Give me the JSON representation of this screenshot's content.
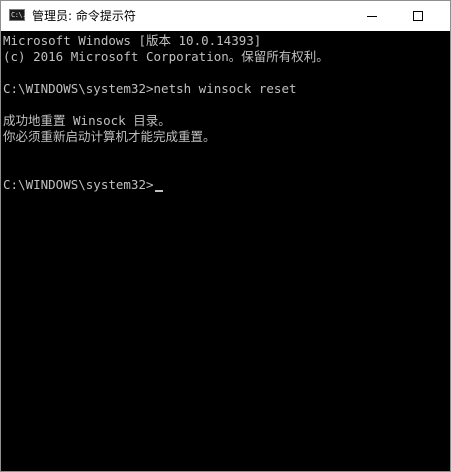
{
  "window": {
    "title": "管理员: 命令提示符",
    "app_icon_glyph": "C:\\."
  },
  "controls": {
    "minimize_icon": "minimize-icon",
    "maximize_icon": "maximize-icon"
  },
  "console": {
    "lines": [
      "Microsoft Windows [版本 10.0.14393]",
      "(c) 2016 Microsoft Corporation。保留所有权利。",
      "",
      "C:\\WINDOWS\\system32>netsh winsock reset",
      "",
      "成功地重置 Winsock 目录。",
      "你必须重新启动计算机才能完成重置。",
      "",
      "",
      "C:\\WINDOWS\\system32>"
    ],
    "colors": {
      "background": "#000000",
      "text": "#c0c0c0"
    }
  }
}
